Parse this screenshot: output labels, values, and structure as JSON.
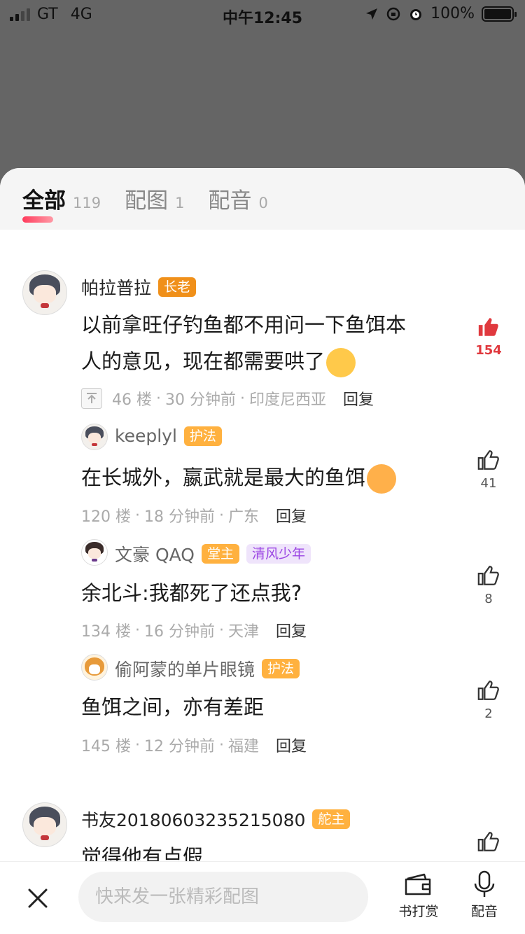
{
  "status_bar": {
    "carrier": "GT",
    "network": "4G",
    "time": "中午12:45",
    "battery": "100%"
  },
  "tabs": [
    {
      "label": "全部",
      "count": "119",
      "active": true
    },
    {
      "label": "配图",
      "count": "1"
    },
    {
      "label": "配音",
      "count": "0"
    }
  ],
  "comments": [
    {
      "user": "帕拉普拉",
      "badge": "长老",
      "text_line1": "以前拿旺仔钓鱼都不用问一下鱼饵本",
      "text_line2": "人的意见，现在都需要哄了",
      "floor": "46 楼",
      "time": "30 分钟前",
      "location": "印度尼西亚",
      "reply": "回复",
      "likes": "154"
    },
    {
      "user": "keeplyl",
      "badge": "护法",
      "text": "在长城外，嬴武就是最大的鱼饵",
      "floor": "120 楼",
      "time": "18 分钟前",
      "location": "广东",
      "reply": "回复",
      "likes": "41"
    },
    {
      "user": "文豪 QAQ",
      "badge": "堂主",
      "badge2": "清风少年",
      "text": "余北斗:我都死了还点我?",
      "floor": "134 楼",
      "time": "16 分钟前",
      "location": "天津",
      "reply": "回复",
      "likes": "8"
    },
    {
      "user": "偷阿蒙的单片眼镜",
      "badge": "护法",
      "text": "鱼饵之间，亦有差距",
      "floor": "145 楼",
      "time": "12 分钟前",
      "location": "福建",
      "reply": "回复",
      "likes": "2"
    },
    {
      "user": "书友20180603235215080",
      "badge": "舵主",
      "text": "觉得他有点假"
    }
  ],
  "bottom_bar": {
    "placeholder": "快来发一张精彩配图",
    "reward_label": "书打赏",
    "dub_label": "配音"
  }
}
